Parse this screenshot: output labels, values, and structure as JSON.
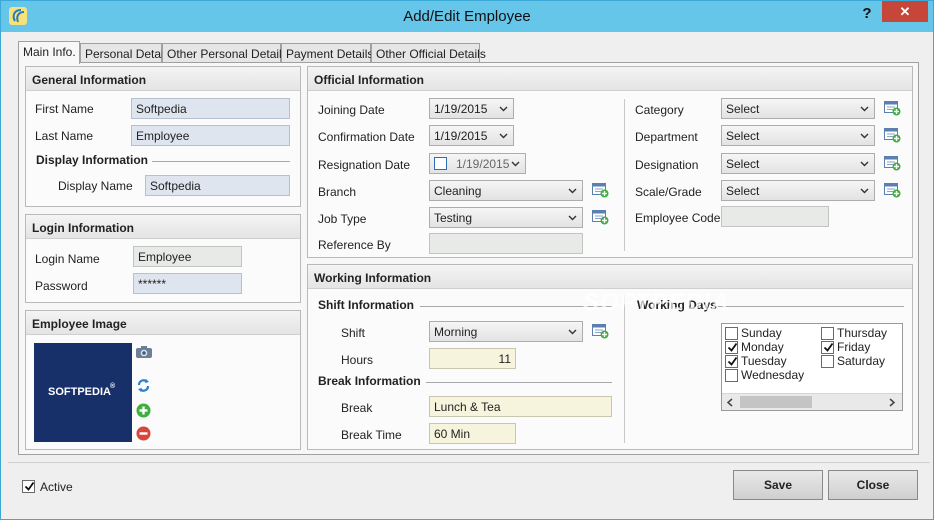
{
  "window": {
    "title": "Add/Edit Employee",
    "help_label": "?",
    "close_label": "✕"
  },
  "tabs": [
    {
      "label": "Main Info."
    },
    {
      "label": "Personal Detail"
    },
    {
      "label": "Other Personal Details"
    },
    {
      "label": "Payment Details"
    },
    {
      "label": "Other Official Details"
    }
  ],
  "general": {
    "title": "General Information",
    "first_name_label": "First Name",
    "first_name": "Softpedia",
    "last_name_label": "Last Name",
    "last_name": "Employee",
    "display_title": "Display Information",
    "display_name_label": "Display Name",
    "display_name": "Softpedia"
  },
  "login": {
    "title": "Login Information",
    "login_name_label": "Login Name",
    "login_name": "Employee",
    "password_label": "Password",
    "password": "******"
  },
  "image": {
    "title": "Employee Image",
    "logo_text": "SOFTPEDIA",
    "logo_mark": "®"
  },
  "official": {
    "title": "Official Information",
    "joining_label": "Joining Date",
    "joining": "1/19/2015",
    "confirmation_label": "Confirmation Date",
    "confirmation": "1/19/2015",
    "resignation_label": "Resignation Date",
    "resignation": "1/19/2015",
    "branch_label": "Branch",
    "branch": "Cleaning",
    "jobtype_label": "Job Type",
    "jobtype": "Testing",
    "reference_label": "Reference By",
    "reference": "",
    "category_label": "Category",
    "category": "Select",
    "department_label": "Department",
    "department": "Select",
    "designation_label": "Designation",
    "designation": "Select",
    "scale_label": "Scale/Grade",
    "scale": "Select",
    "empcode_label": "Employee Code",
    "empcode": ""
  },
  "working": {
    "title": "Working Information",
    "shift_title": "Shift Information",
    "shift_label": "Shift",
    "shift": "Morning",
    "hours_label": "Hours",
    "hours": "11",
    "break_title": "Break Information",
    "break_label": "Break",
    "break": "Lunch & Tea",
    "break_time_label": "Break Time",
    "break_time": "60 Min",
    "days_title": "Working Days",
    "days": [
      {
        "label": "Sunday",
        "checked": false
      },
      {
        "label": "Monday",
        "checked": true
      },
      {
        "label": "Tuesday",
        "checked": true
      },
      {
        "label": "Wednesday",
        "checked": false
      },
      {
        "label": "Thursday",
        "checked": false
      },
      {
        "label": "Friday",
        "checked": true
      },
      {
        "label": "Saturday",
        "checked": false
      }
    ]
  },
  "footer": {
    "active_label": "Active",
    "active_checked": true,
    "save_label": "Save",
    "close_label": "Close"
  },
  "watermark": "SOFTPEDIA",
  "colors": {
    "titlebar": "#65c6ea",
    "close": "#c7463a",
    "logo_bg": "#17306a"
  }
}
